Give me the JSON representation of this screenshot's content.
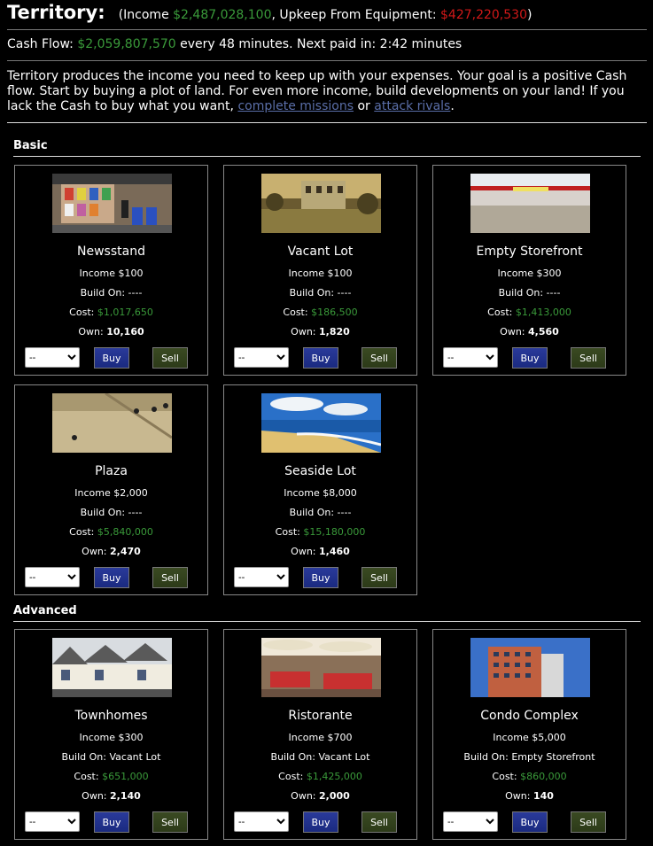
{
  "header": {
    "title": "Territory:",
    "income_prefix": "(Income ",
    "income_value": "$2,487,028,100",
    "upkeep_label": ", Upkeep From Equipment: ",
    "upkeep_value": "$427,220,530",
    "close_paren": ")"
  },
  "cashflow": {
    "label": "Cash Flow: ",
    "value": "$2,059,807,570",
    "suffix": " every 48 minutes. Next paid in: 2:42 minutes"
  },
  "intro": {
    "text": "Territory produces the income you need to keep up with your expenses. Your goal is a positive Cash flow. Start by buying a plot of land. For even more income, build developments on your land! If you lack the Cash to buy what you want, ",
    "link1": "complete missions",
    "or": " or ",
    "link2": "attack rivals",
    "end": "."
  },
  "sections": {
    "basic": "Basic",
    "advanced": "Advanced"
  },
  "labels": {
    "income": "Income ",
    "build_on": "Build On: ",
    "cost": "Cost: ",
    "own": "Own: ",
    "buy": "Buy",
    "sell": "Sell",
    "select_default": "--"
  },
  "properties": [
    {
      "name": "Newsstand",
      "income": "$100",
      "build_on": "----",
      "cost": "$1,017,650",
      "own": "10,160"
    },
    {
      "name": "Vacant Lot",
      "income": "$100",
      "build_on": "----",
      "cost": "$186,500",
      "own": "1,820"
    },
    {
      "name": "Empty Storefront",
      "income": "$300",
      "build_on": "----",
      "cost": "$1,413,000",
      "own": "4,560"
    },
    {
      "name": "Plaza",
      "income": "$2,000",
      "build_on": "----",
      "cost": "$5,840,000",
      "own": "2,470"
    },
    {
      "name": "Seaside Lot",
      "income": "$8,000",
      "build_on": "----",
      "cost": "$15,180,000",
      "own": "1,460"
    },
    {
      "name": "Townhomes",
      "income": "$300",
      "build_on": "Vacant Lot",
      "cost": "$651,000",
      "own": "2,140"
    },
    {
      "name": "Ristorante",
      "income": "$700",
      "build_on": "Vacant Lot",
      "cost": "$1,425,000",
      "own": "2,000"
    },
    {
      "name": "Condo Complex",
      "income": "$5,000",
      "build_on": "Empty Storefront",
      "cost": "$860,000",
      "own": "140"
    }
  ],
  "colors": {
    "money_green": "#3a9a3a",
    "upkeep_red": "#d01818",
    "buy_blue": "#1f2f8c",
    "sell_olive": "#34421c"
  }
}
